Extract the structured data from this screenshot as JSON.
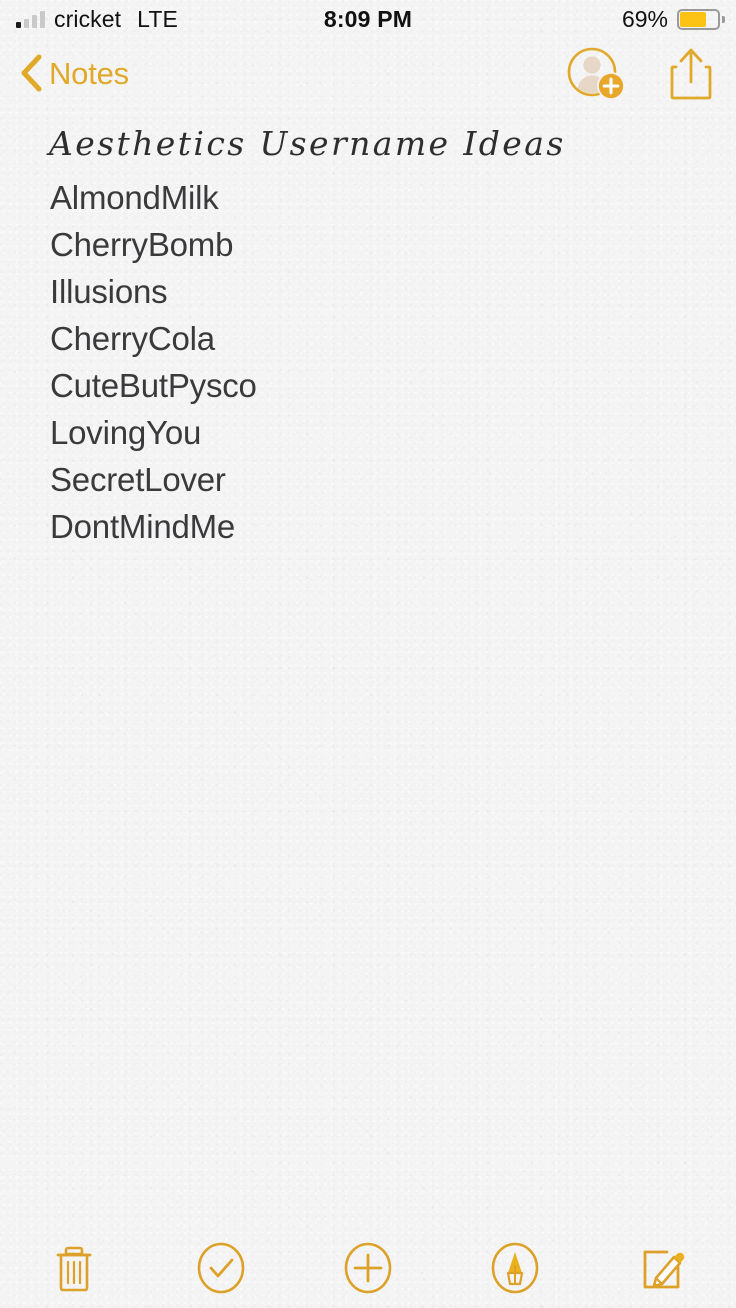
{
  "status_bar": {
    "carrier": "cricket",
    "radio": "LTE",
    "time": "8:09 PM",
    "battery_percent": "69%",
    "battery_level": 69,
    "signal_bars_filled": 1,
    "signal_bars_total": 4,
    "battery_color": "#fcc314"
  },
  "nav": {
    "back_label": "Notes",
    "back_icon": "chevron-left-icon",
    "collaborate_icon": "add-person-icon",
    "share_icon": "share-icon",
    "accent_color": "#e0a92a"
  },
  "note": {
    "title": "Aesthetics Username Ideas",
    "lines": [
      "AlmondMilk",
      "CherryBomb",
      "Illusions",
      "CherryCola",
      "CuteButPysco",
      "LovingYou",
      "SecretLover",
      "DontMindMe"
    ],
    "text_color": "#3a3a3c",
    "background_color": "#f4f4f4"
  },
  "toolbar": {
    "items": [
      {
        "name": "delete-button",
        "icon": "trash-icon"
      },
      {
        "name": "checklist-button",
        "icon": "checkmark-circle-icon"
      },
      {
        "name": "add-button",
        "icon": "plus-circle-icon"
      },
      {
        "name": "markup-button",
        "icon": "markup-pen-circle-icon"
      },
      {
        "name": "compose-button",
        "icon": "compose-icon"
      }
    ],
    "accent_color": "#dda12a"
  }
}
